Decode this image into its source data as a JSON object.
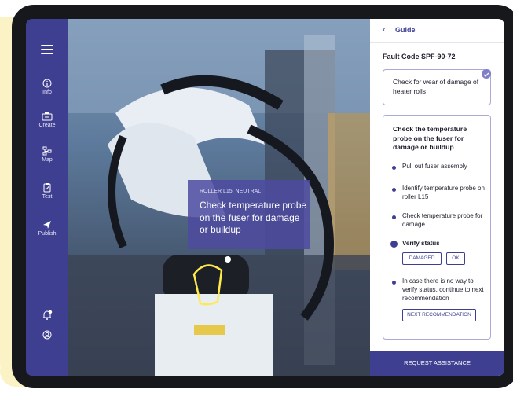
{
  "sidebar": {
    "items": [
      {
        "label": "Info",
        "icon": "info-icon"
      },
      {
        "label": "Create",
        "icon": "create-icon"
      },
      {
        "label": "Map",
        "icon": "map-icon"
      },
      {
        "label": "Test",
        "icon": "test-icon"
      },
      {
        "label": "Publish",
        "icon": "publish-icon"
      }
    ],
    "bottom_icons": [
      "notification-bell-icon",
      "user-icon"
    ]
  },
  "overlay": {
    "subtitle": "ROLLER L15, NEUTRAL",
    "text": "Check temperature probe on the fuser for damage or buildup"
  },
  "guide": {
    "back_label": "‹",
    "title": "Guide",
    "fault_code": "Fault Code SPF-90-72",
    "card1": "Check for wear of damage of heater rolls",
    "card2_title": "Check the temperature probe on the fuser for damage or buildup",
    "steps": [
      "Pull out fuser assembly",
      "Identify temperature probe on roller L15",
      "Check temperature probe for damage",
      "Verify status",
      "In case there is no way to verify status, continue to next recommendation"
    ],
    "damaged_label": "DAMAGED",
    "ok_label": "OK",
    "next_label": "NEXT RECOMMENDATION",
    "request_label": "REQUEST ASSISTANCE"
  },
  "colors": {
    "accent": "#3f3f92",
    "highlight": "#ffe94d",
    "background_tint": "#fbf3c6"
  }
}
